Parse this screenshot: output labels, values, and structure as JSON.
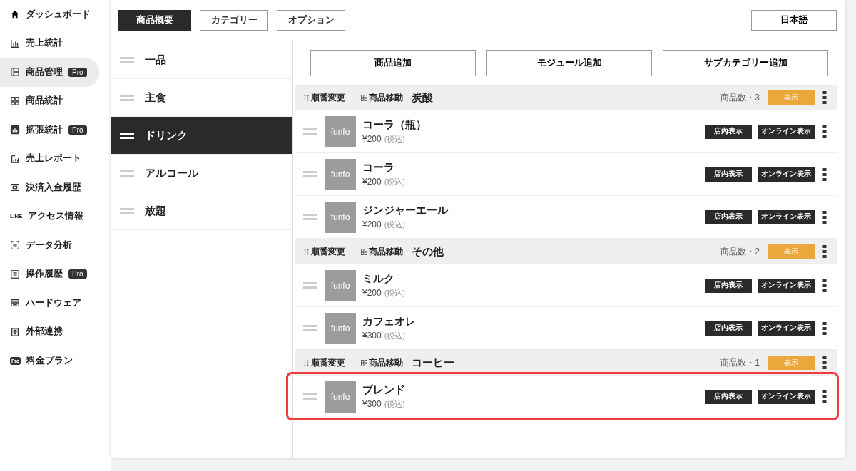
{
  "sidebar": {
    "items": [
      {
        "label": "ダッシュボード",
        "selected": false
      },
      {
        "label": "売上統計",
        "selected": false
      },
      {
        "label": "商品管理",
        "badge": "Pro",
        "selected": true
      },
      {
        "label": "商品統計",
        "selected": false
      },
      {
        "label": "拡張統計",
        "badge": "Pro",
        "selected": false
      },
      {
        "label": "売上レポート",
        "selected": false
      },
      {
        "label": "決済入金履歴",
        "selected": false
      },
      {
        "label": "アクセス情報",
        "icon_text": "LINE",
        "selected": false
      },
      {
        "label": "データ分析",
        "selected": false
      },
      {
        "label": "操作履歴",
        "badge": "Pro",
        "selected": false
      },
      {
        "label": "ハードウェア",
        "selected": false
      },
      {
        "label": "外部連携",
        "selected": false
      },
      {
        "label": "料金プラン",
        "icon_text": "Pro",
        "selected": false
      }
    ]
  },
  "tabs": [
    {
      "label": "商品概要",
      "selected": true
    },
    {
      "label": "カテゴリー",
      "selected": false
    },
    {
      "label": "オプション",
      "selected": false
    }
  ],
  "language_button": "日本語",
  "categories": [
    {
      "label": "一品",
      "selected": false
    },
    {
      "label": "主食",
      "selected": false
    },
    {
      "label": "ドリンク",
      "selected": true
    },
    {
      "label": "アルコール",
      "selected": false
    },
    {
      "label": "放題",
      "selected": false
    }
  ],
  "actions": [
    "商品追加",
    "モジュール追加",
    "サブカテゴリー追加"
  ],
  "groups": [
    {
      "reorder": "順番変更",
      "move": "商品移動",
      "name": "炭酸",
      "count": "商品数・3",
      "visibility": "表示",
      "items": [
        {
          "name": "コーラ（瓶）",
          "thumb": "funfo",
          "price": "¥200",
          "tax": "(税込)",
          "store": "店内表示",
          "online": "オンライン表示",
          "highlighted": false
        },
        {
          "name": "コーラ",
          "thumb": "funfo",
          "price": "¥200",
          "tax": "(税込)",
          "store": "店内表示",
          "online": "オンライン表示",
          "highlighted": false
        },
        {
          "name": "ジンジャーエール",
          "thumb": "funfo",
          "price": "¥200",
          "tax": "(税込)",
          "store": "店内表示",
          "online": "オンライン表示",
          "highlighted": false
        }
      ]
    },
    {
      "reorder": "順番変更",
      "move": "商品移動",
      "name": "その他",
      "count": "商品数・2",
      "visibility": "表示",
      "items": [
        {
          "name": "ミルク",
          "thumb": "funfo",
          "price": "¥200",
          "tax": "(税込)",
          "store": "店内表示",
          "online": "オンライン表示",
          "highlighted": false
        },
        {
          "name": "カフェオレ",
          "thumb": "funfo",
          "price": "¥300",
          "tax": "(税込)",
          "store": "店内表示",
          "online": "オンライン表示",
          "highlighted": false
        }
      ]
    },
    {
      "reorder": "順番変更",
      "move": "商品移動",
      "name": "コーヒー",
      "count": "商品数・1",
      "visibility": "表示",
      "items": [
        {
          "name": "ブレンド",
          "thumb": "funfo",
          "price": "¥300",
          "tax": "(税込)",
          "store": "店内表示",
          "online": "オンライン表示",
          "highlighted": true
        }
      ]
    }
  ]
}
